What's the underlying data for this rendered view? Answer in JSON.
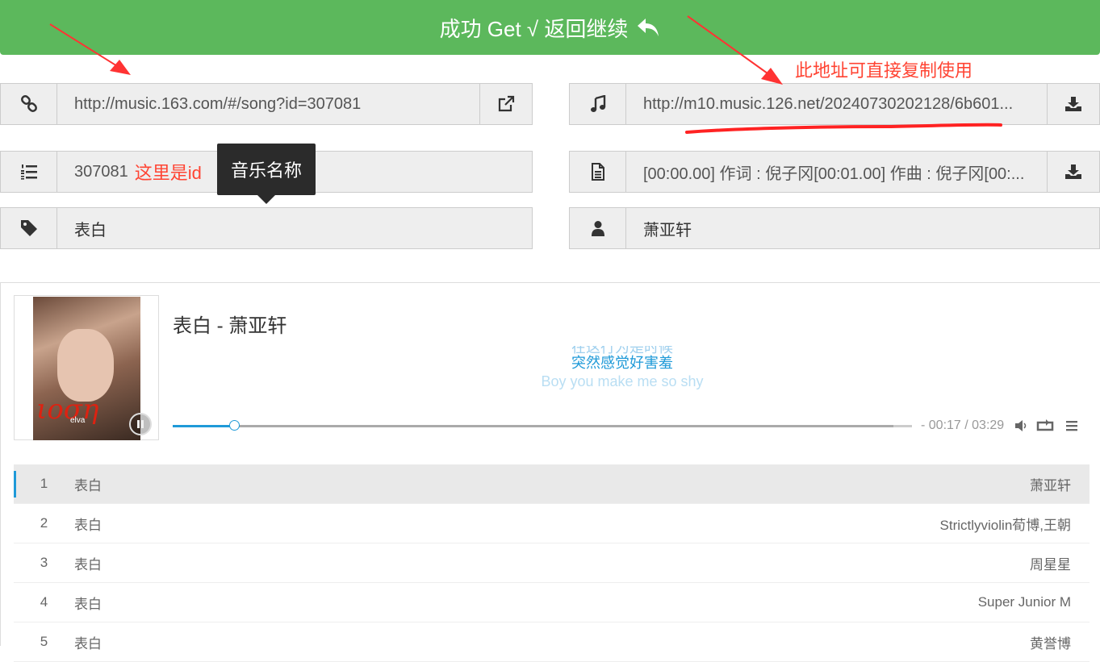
{
  "banner": {
    "text": "成功 Get √ 返回继续"
  },
  "annotations": {
    "copy_hint": "此地址可直接复制使用",
    "id_hint": "这里是id",
    "tooltip": "音乐名称"
  },
  "fields": {
    "song_url": "http://music.163.com/#/song?id=307081",
    "source_url": "http://m10.music.126.net/20240730202128/6b601...",
    "song_id": "307081",
    "lyrics_preview": "[00:00.00] 作词 : 倪子冈[00:01.00] 作曲 : 倪子冈[00:...",
    "song_name": "表白",
    "artist": "萧亚轩"
  },
  "player": {
    "title": "表白 - 萧亚轩",
    "cover_text": "elva",
    "lyric_prev": "在这行为是时候",
    "lyric_current": "突然感觉好害羞",
    "lyric_next": "Boy you make me so shy",
    "time": "- 00:17 / 03:29",
    "progress_played": 0.083,
    "progress_loaded": 0.975
  },
  "playlist": [
    {
      "num": "1",
      "name": "表白",
      "artist": "萧亚轩"
    },
    {
      "num": "2",
      "name": "表白",
      "artist": "Strictlyviolin荀博,王朝"
    },
    {
      "num": "3",
      "name": "表白",
      "artist": "周星星"
    },
    {
      "num": "4",
      "name": "表白",
      "artist": "Super Junior M"
    },
    {
      "num": "5",
      "name": "表白",
      "artist": "黄誉博"
    }
  ],
  "colors": {
    "banner": "#5cb85c",
    "accent": "#1f9ad8",
    "annotation": "#ff4433"
  }
}
